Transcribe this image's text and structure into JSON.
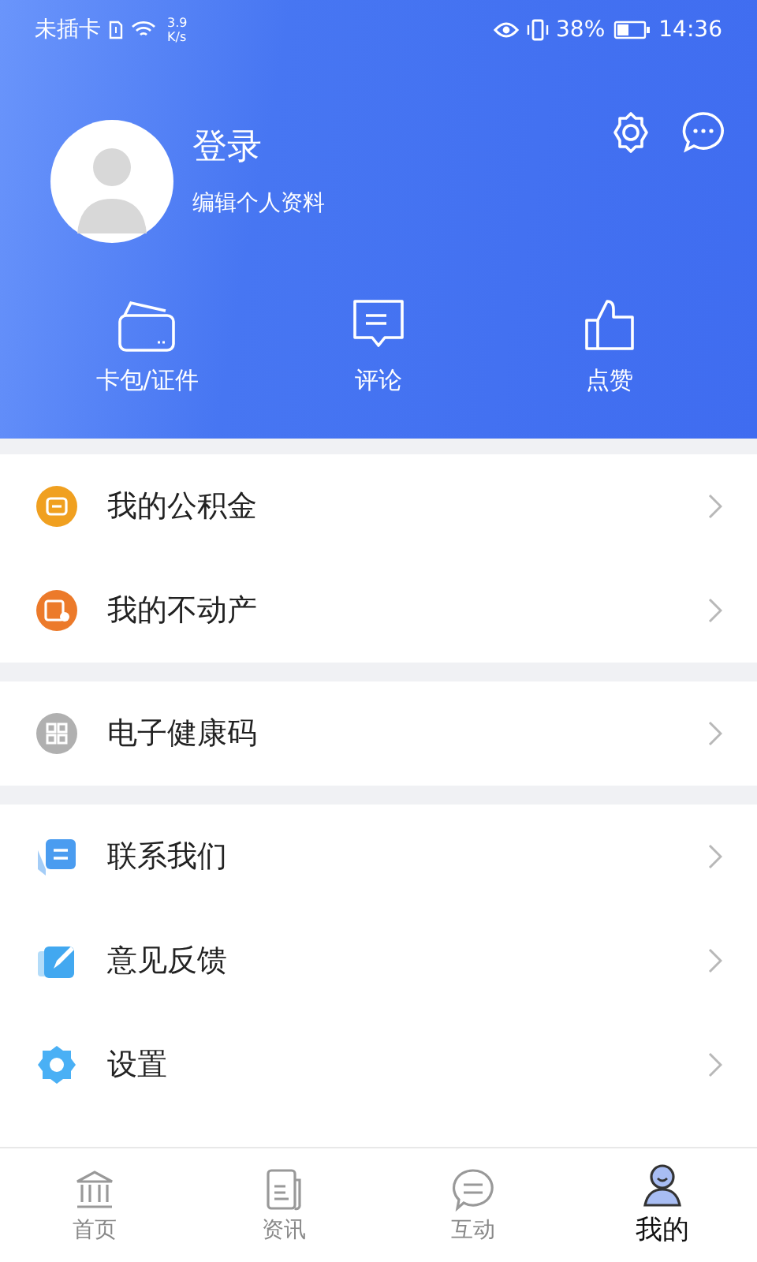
{
  "status_bar": {
    "carrier": "未插卡",
    "speed_value": "3.9",
    "speed_unit": "K/s",
    "battery": "38%",
    "time": "14:36"
  },
  "profile": {
    "name": "登录",
    "subtitle": "编辑个人资料"
  },
  "actions": [
    {
      "kind": "wallet",
      "label": "卡包/证件"
    },
    {
      "kind": "comment",
      "label": "评论"
    },
    {
      "kind": "like",
      "label": "点赞"
    }
  ],
  "menu_groups": [
    [
      {
        "kind": "fund",
        "label": "我的公积金",
        "color": "#f0a020"
      },
      {
        "kind": "property",
        "label": "我的不动产",
        "color": "#ec7a2a"
      }
    ],
    [
      {
        "kind": "qrcode",
        "label": "电子健康码",
        "color": "#b0b0b0"
      }
    ],
    [
      {
        "kind": "contact",
        "label": "联系我们",
        "color": "#4a9cf0"
      },
      {
        "kind": "feedback",
        "label": "意见反馈",
        "color": "#42a8f0"
      },
      {
        "kind": "settings",
        "label": "设置",
        "color": "#4ab0f5"
      }
    ]
  ],
  "tabs": [
    {
      "kind": "home",
      "label": "首页",
      "selected": false
    },
    {
      "kind": "news",
      "label": "资讯",
      "selected": false
    },
    {
      "kind": "chat",
      "label": "互动",
      "selected": false
    },
    {
      "kind": "me",
      "label": "我的",
      "selected": true
    }
  ]
}
